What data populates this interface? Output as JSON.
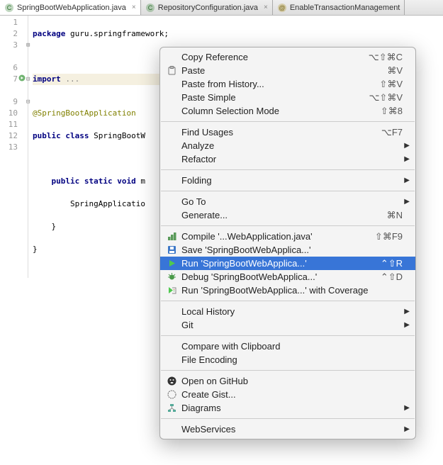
{
  "tabs": [
    {
      "label": "SpringBootWebApplication.java",
      "active": true
    },
    {
      "label": "RepositoryConfiguration.java",
      "active": false
    },
    {
      "label": "EnableTransactionManagement",
      "active": false
    }
  ],
  "gutter_lines": [
    "1",
    "2",
    "3",
    "",
    "6",
    "7",
    "",
    "9",
    "10",
    "11",
    "12",
    "13"
  ],
  "code": {
    "l1_kw": "package",
    "l1_rest": " guru.springframework;",
    "l3_kw": "import",
    "l3_rest": " ...",
    "l6": "@SpringBootApplication",
    "l7_kw1": "public class",
    "l7_rest": " SpringBootW",
    "l9_kw1": "public static void",
    "l9_rest": " m",
    "l10": "        SpringApplicatio",
    "l11": "    }",
    "l12": "}"
  },
  "menu": {
    "copy_reference": "Copy Reference",
    "copy_reference_sc": "⌥⇧⌘C",
    "paste": "Paste",
    "paste_sc": "⌘V",
    "paste_history": "Paste from History...",
    "paste_history_sc": "⇧⌘V",
    "paste_simple": "Paste Simple",
    "paste_simple_sc": "⌥⇧⌘V",
    "column_sel": "Column Selection Mode",
    "column_sel_sc": "⇧⌘8",
    "find_usages": "Find Usages",
    "find_usages_sc": "⌥F7",
    "analyze": "Analyze",
    "refactor": "Refactor",
    "folding": "Folding",
    "goto": "Go To",
    "generate": "Generate...",
    "generate_sc": "⌘N",
    "compile": "Compile '...WebApplication.java'",
    "compile_sc": "⇧⌘F9",
    "save": "Save 'SpringBootWebApplica...'",
    "run": "Run 'SpringBootWebApplica...'",
    "run_sc": "⌃⇧R",
    "debug": "Debug 'SpringBootWebApplica...'",
    "debug_sc": "⌃⇧D",
    "run_cov": "Run 'SpringBootWebApplica...' with Coverage",
    "local_history": "Local History",
    "git": "Git",
    "compare_clip": "Compare with Clipboard",
    "file_enc": "File Encoding",
    "open_github": "Open on GitHub",
    "create_gist": "Create Gist...",
    "diagrams": "Diagrams",
    "webservices": "WebServices"
  }
}
